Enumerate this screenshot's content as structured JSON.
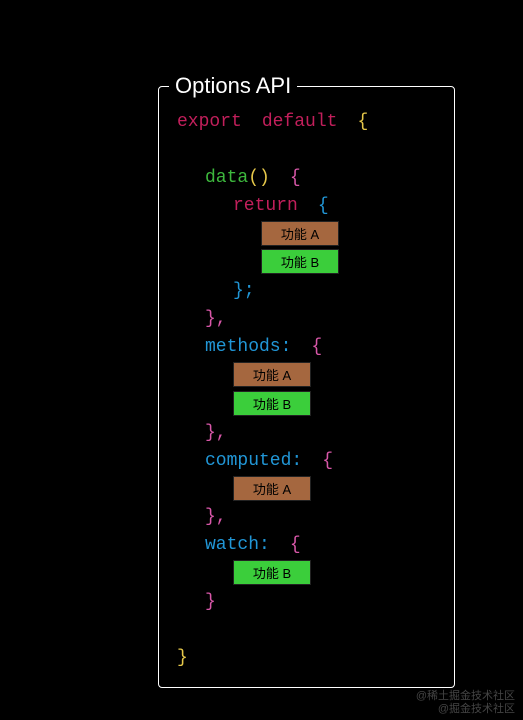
{
  "panel": {
    "title": "Options API"
  },
  "code": {
    "export": "export",
    "default": "default",
    "data": "data",
    "return": "return",
    "methods": "methods:",
    "computed": "computed:",
    "watch": "watch:",
    "openParen": "()",
    "braceOpen": "{",
    "braceClose": "}",
    "braceCloseComma": "},",
    "braceCloseSemi": "};"
  },
  "tags": {
    "featureA": "功能 A",
    "featureB": "功能 B"
  },
  "watermark": {
    "line1": "@稀土掘金技术社区",
    "line2": "@掘金技术社区"
  }
}
